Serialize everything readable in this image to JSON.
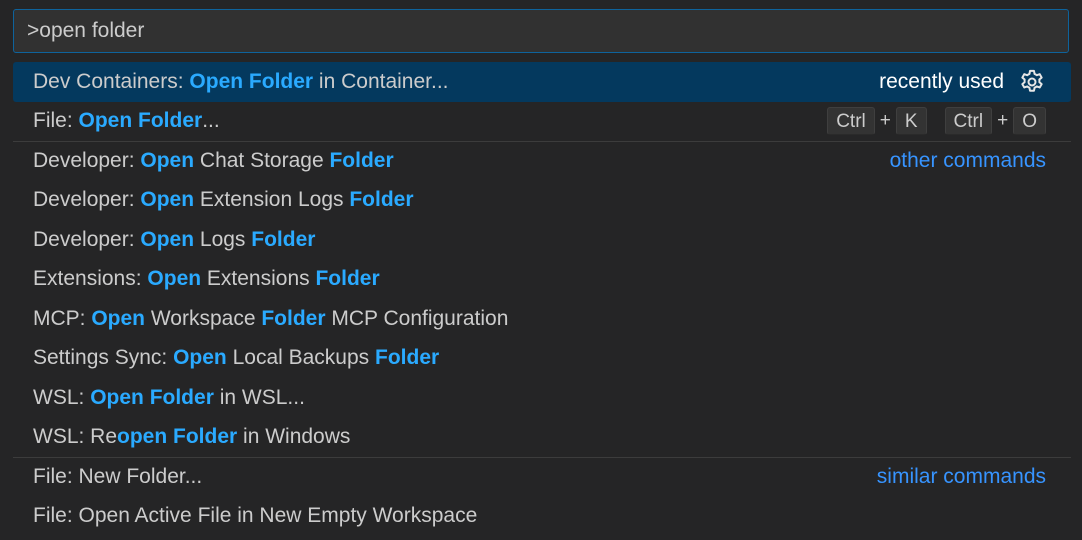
{
  "quick_open": {
    "input_value": ">open folder"
  },
  "rows": [
    {
      "parts": [
        {
          "t": "Dev Containers: ",
          "m": false
        },
        {
          "t": "Open Folder",
          "m": true
        },
        {
          "t": " in Container...",
          "m": false
        }
      ],
      "selected": true,
      "separator": false,
      "right_label": "recently used",
      "gear_icon": "gear-icon"
    },
    {
      "parts": [
        {
          "t": "File: ",
          "m": false
        },
        {
          "t": "Open Folder",
          "m": true
        },
        {
          "t": "...",
          "m": false
        }
      ],
      "keybinding": [
        [
          "Ctrl",
          "K"
        ],
        [
          "Ctrl",
          "O"
        ]
      ],
      "plus": "+"
    },
    {
      "parts": [
        {
          "t": "Developer: ",
          "m": false
        },
        {
          "t": "Open",
          "m": true
        },
        {
          "t": " Chat Storage ",
          "m": false
        },
        {
          "t": "Folder",
          "m": true
        }
      ],
      "separator": true,
      "group_label": "other commands"
    },
    {
      "parts": [
        {
          "t": "Developer: ",
          "m": false
        },
        {
          "t": "Open",
          "m": true
        },
        {
          "t": " Extension Logs ",
          "m": false
        },
        {
          "t": "Folder",
          "m": true
        }
      ]
    },
    {
      "parts": [
        {
          "t": "Developer: ",
          "m": false
        },
        {
          "t": "Open",
          "m": true
        },
        {
          "t": " Logs ",
          "m": false
        },
        {
          "t": "Folder",
          "m": true
        }
      ]
    },
    {
      "parts": [
        {
          "t": "Extensions: ",
          "m": false
        },
        {
          "t": "Open",
          "m": true
        },
        {
          "t": " Extensions ",
          "m": false
        },
        {
          "t": "Folder",
          "m": true
        }
      ]
    },
    {
      "parts": [
        {
          "t": "MCP: ",
          "m": false
        },
        {
          "t": "Open",
          "m": true
        },
        {
          "t": " Workspace ",
          "m": false
        },
        {
          "t": "Folder",
          "m": true
        },
        {
          "t": " MCP Configuration",
          "m": false
        }
      ]
    },
    {
      "parts": [
        {
          "t": "Settings Sync: ",
          "m": false
        },
        {
          "t": "Open",
          "m": true
        },
        {
          "t": " Local Backups ",
          "m": false
        },
        {
          "t": "Folder",
          "m": true
        }
      ]
    },
    {
      "parts": [
        {
          "t": "WSL: ",
          "m": false
        },
        {
          "t": "Open Folder",
          "m": true
        },
        {
          "t": " in WSL...",
          "m": false
        }
      ]
    },
    {
      "parts": [
        {
          "t": "WSL: Re",
          "m": false
        },
        {
          "t": "open Folder",
          "m": true
        },
        {
          "t": " in Windows",
          "m": false
        }
      ]
    },
    {
      "parts": [
        {
          "t": "File: New Folder...",
          "m": false
        }
      ],
      "separator": true,
      "group_label": "similar commands"
    },
    {
      "parts": [
        {
          "t": "File: Open Active File in New Empty Workspace",
          "m": false
        }
      ]
    }
  ],
  "colors": {
    "background": "#252526",
    "input_border": "#0e639c",
    "selected_row": "#04395e",
    "highlight": "#2aaaff",
    "link": "#3794ff"
  }
}
